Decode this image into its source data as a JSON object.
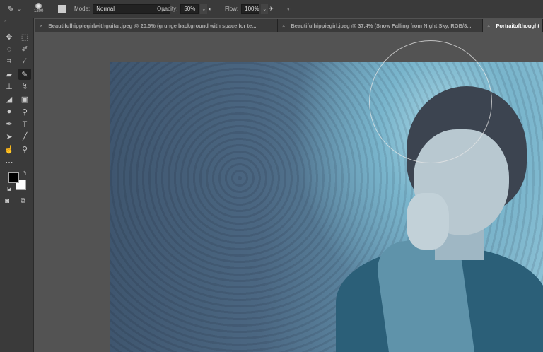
{
  "options_bar": {
    "brush_size": "1200",
    "mode_label": "Mode:",
    "mode_value": "Normal",
    "opacity_label": "Opacity:",
    "opacity_value": "50%",
    "flow_label": "Flow:",
    "flow_value": "100%"
  },
  "tabs": [
    {
      "label": "Beautifulhippiegirlwithguitar.jpeg @ 20.5% (grunge background with space for te...",
      "active": false
    },
    {
      "label": "Beautifulhippiegirl.jpeg @ 37.4% (Snow Falling from Night Sky, RGB/8...",
      "active": false
    },
    {
      "label": "Portraitofthought",
      "active": true
    }
  ],
  "tools": [
    "move",
    "rectangular-marquee",
    "lasso",
    "quick-selection",
    "crop",
    "eyedropper",
    "healing-brush",
    "brush",
    "clone-stamp",
    "history-brush",
    "eraser",
    "gradient",
    "blur",
    "dodge",
    "pen",
    "type",
    "path-selection",
    "line",
    "smudge",
    "zoom",
    "more"
  ],
  "active_tool": "brush",
  "colors": {
    "foreground": "#000000",
    "background": "#ffffff"
  }
}
